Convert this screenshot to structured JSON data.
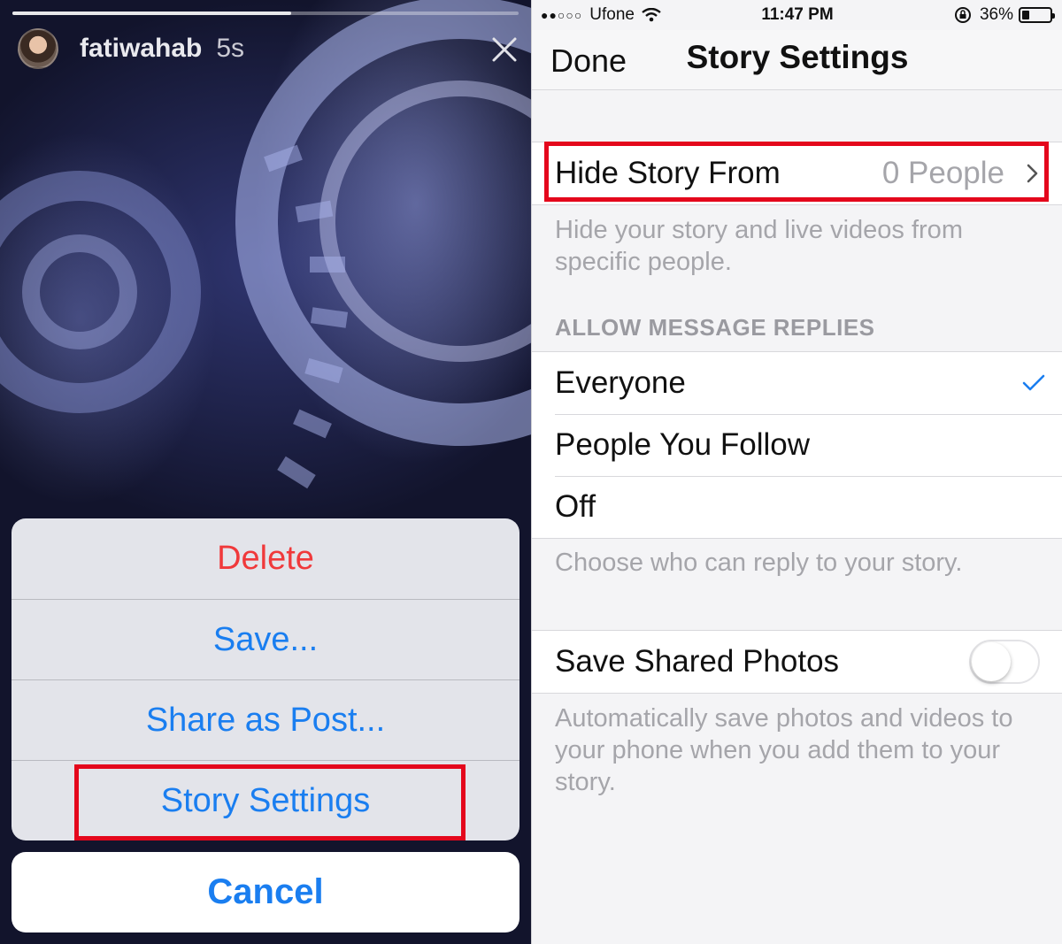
{
  "story": {
    "username": "fatiwahab",
    "timestamp": "5s",
    "progress": 0.55,
    "icons": {
      "close": "close-icon",
      "avatar": "avatar"
    }
  },
  "action_sheet": {
    "items": [
      {
        "label": "Delete",
        "style": "destructive"
      },
      {
        "label": "Save..."
      },
      {
        "label": "Share as Post..."
      },
      {
        "label": "Story Settings"
      }
    ],
    "cancel_label": "Cancel"
  },
  "status_bar": {
    "signal": "●●○○○",
    "carrier": "Ufone",
    "time": "11:47 PM",
    "battery": "36%",
    "battery_level": 0.36
  },
  "settings": {
    "nav": {
      "done_label": "Done",
      "title": "Story Settings"
    },
    "hide_story": {
      "label": "Hide Story From",
      "value": "0 People"
    },
    "hide_story_footer": "Hide your story and live videos from specific people.",
    "replies_header": "ALLOW MESSAGE REPLIES",
    "replies_options": [
      {
        "label": "Everyone",
        "selected": true
      },
      {
        "label": "People You Follow",
        "selected": false
      },
      {
        "label": "Off",
        "selected": false
      }
    ],
    "replies_footer": "Choose who can reply to your story.",
    "save_photos": {
      "label": "Save Shared Photos",
      "enabled": false
    },
    "save_photos_footer": "Automatically save photos and videos to your phone when you add them to your story."
  },
  "colors": {
    "ios_blue": "#1a7ef0",
    "destructive_red": "#f0393b",
    "highlight_red": "#e4071c",
    "secondary_text": "#a5a5aa"
  }
}
